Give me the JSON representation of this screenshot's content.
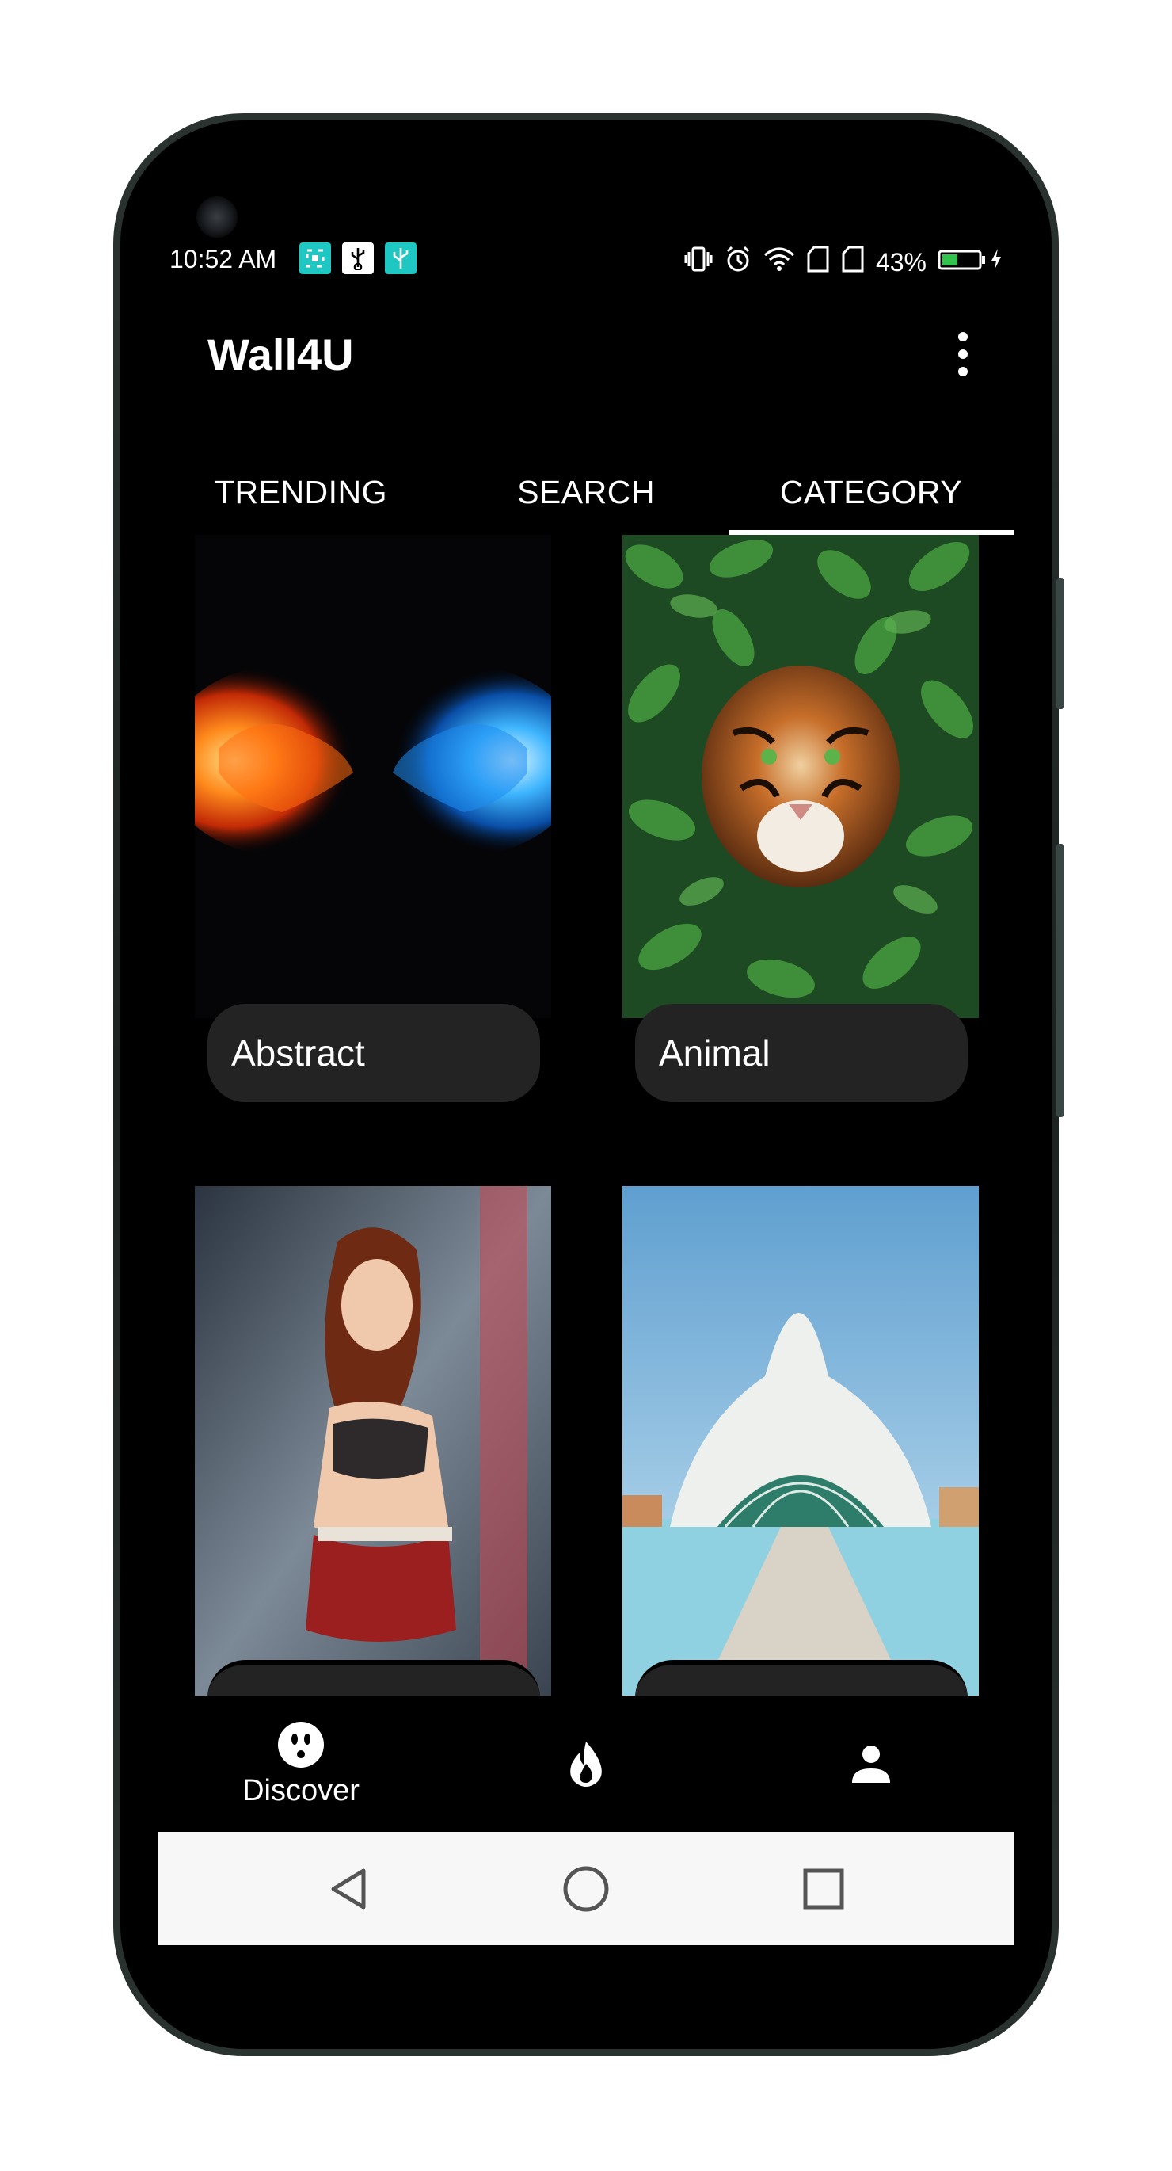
{
  "status_bar": {
    "time": "10:52 AM",
    "battery": "43%",
    "battery_level": 0.43,
    "left_icons": [
      "screenshot-icon",
      "usb-icon",
      "usb-debug-icon"
    ],
    "right_icons": [
      "vibrate-icon",
      "alarm-icon",
      "wifi-icon",
      "sim1-icon",
      "sim2-icon",
      "battery-icon",
      "charging-icon"
    ]
  },
  "app_bar": {
    "title": "Wall4U",
    "menu_icon": "more-vert-icon"
  },
  "tabs": [
    {
      "label": "TRENDING",
      "active": false
    },
    {
      "label": "SEARCH",
      "active": false
    },
    {
      "label": "CATEGORY",
      "active": true
    }
  ],
  "categories": [
    {
      "label": "Abstract"
    },
    {
      "label": "Animal"
    },
    {
      "label": ""
    },
    {
      "label": ""
    }
  ],
  "bottom_nav": {
    "items": [
      {
        "icon": "discover-icon",
        "label": "Discover",
        "active": true
      },
      {
        "icon": "fire-icon",
        "label": ""
      },
      {
        "icon": "person-icon",
        "label": ""
      }
    ]
  },
  "colors": {
    "background": "#000000",
    "pill": "#232323",
    "accent_teal": "#1fc7c2",
    "battery_green": "#32c24d",
    "system_nav": "#f7f7f7"
  }
}
